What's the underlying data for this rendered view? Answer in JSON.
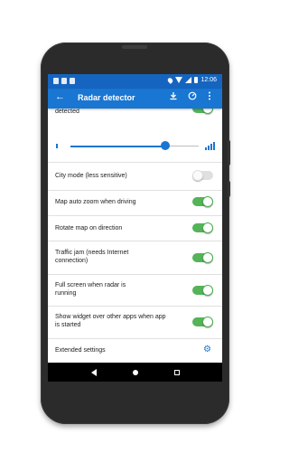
{
  "status_bar": {
    "time": "12:06"
  },
  "app_bar": {
    "title": "Radar detector",
    "back_icon": "arrow-left-icon",
    "download_icon": "download-icon",
    "speed_icon": "gauge-icon",
    "menu_icon": "overflow-menu-icon"
  },
  "partial_item": {
    "label": "detected",
    "toggle_on": true
  },
  "volume_slider": {
    "value_fraction": 0.74,
    "color": "#1976d2"
  },
  "settings": [
    {
      "label": "City mode (less sensitive)",
      "on": false
    },
    {
      "label": "Map auto zoom when driving",
      "on": true
    },
    {
      "label": "Rotate map on direction",
      "on": true
    },
    {
      "label": "Traffic jam (needs Internet connection)",
      "on": true
    },
    {
      "label": "Full screen when radar is running",
      "on": true
    },
    {
      "label": "Show widget over other apps when app is started",
      "on": true
    }
  ],
  "extended": {
    "label": "Extended settings",
    "icon": "gear-icon"
  },
  "colors": {
    "primary": "#1976d2",
    "status_bar": "#1565c0",
    "toggle_on": "#4caf50"
  }
}
